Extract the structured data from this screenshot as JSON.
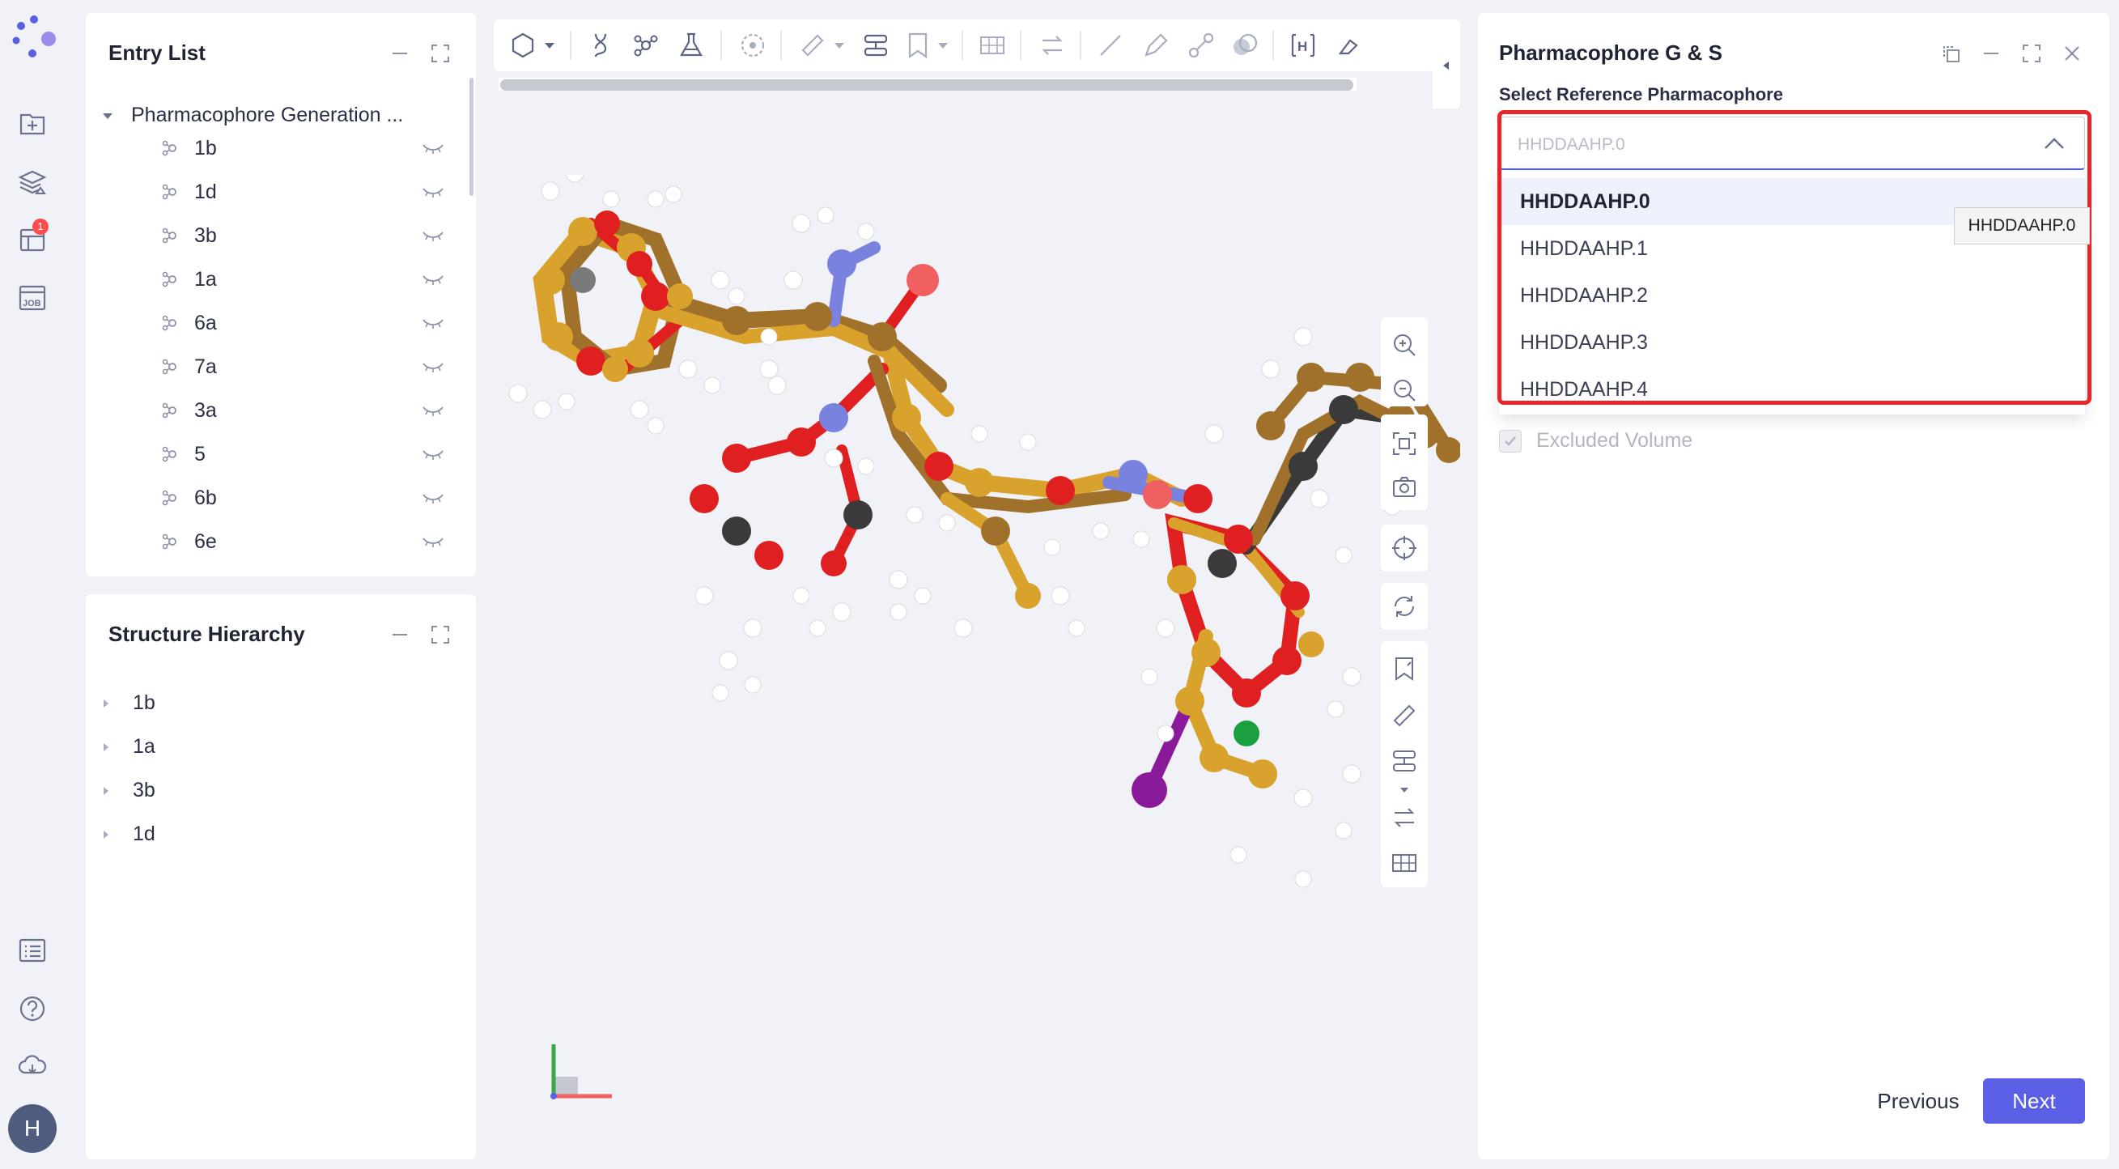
{
  "rail": {
    "icons": [
      "logo-icon",
      "new-file-icon",
      "layers-icon",
      "tasks-icon",
      "job-icon",
      "list-icon",
      "help-icon",
      "cloud-icon"
    ],
    "tasks_badge": "1",
    "avatar_letter": "H"
  },
  "entry_list": {
    "title": "Entry List",
    "root_label": "Pharmacophore Generation ...",
    "items": [
      "1b",
      "1d",
      "3b",
      "1a",
      "6a",
      "7a",
      "3a",
      "5",
      "6b",
      "6e"
    ]
  },
  "structure_hierarchy": {
    "title": "Structure Hierarchy",
    "items": [
      "1b",
      "1a",
      "3b",
      "1d"
    ]
  },
  "viewer": {
    "toolbar_icons": [
      "hexagon-icon",
      "dna-icon",
      "molecule-icon",
      "flask-icon",
      "target-icon",
      "ruler-icon",
      "align-icon",
      "bookmark-icon",
      "grid-icon",
      "swap-icon",
      "line-icon",
      "pencil-icon",
      "bond-icon",
      "overlap-icon",
      "hydrogen-icon",
      "eraser-icon"
    ],
    "hydrogen_label": "H",
    "side_tools": [
      "zoom-in-icon",
      "zoom-out-icon",
      "fit-icon",
      "camera-icon",
      "center-icon",
      "rotate-icon",
      "bookmark-icon",
      "ruler-icon",
      "align-icon",
      "swap-icon",
      "grid-icon"
    ]
  },
  "pharmacophore": {
    "title": "Pharmacophore G & S",
    "select_label": "Select Reference Pharmacophore",
    "select_placeholder": "HHDDAAHP.0",
    "options": [
      "HHDDAAHP.0",
      "HHDDAAHP.1",
      "HHDDAAHP.2",
      "HHDDAAHP.3",
      "HHDDAAHP.4"
    ],
    "tooltip": "HHDDAAHP.0",
    "excluded_volume_label": "Excluded Volume",
    "previous_label": "Previous",
    "next_label": "Next"
  },
  "colors": {
    "accent": "#5a5fe6",
    "highlight_frame": "#e8262a",
    "carbon_gold": "#d9a22c",
    "carbon_bronze": "#a0712a",
    "oxygen": "#e02020",
    "nitrogen": "#7a82e0",
    "hydrogen": "#ffffff",
    "iodine": "#8a1a9a",
    "chlorine": "#1aa040"
  }
}
